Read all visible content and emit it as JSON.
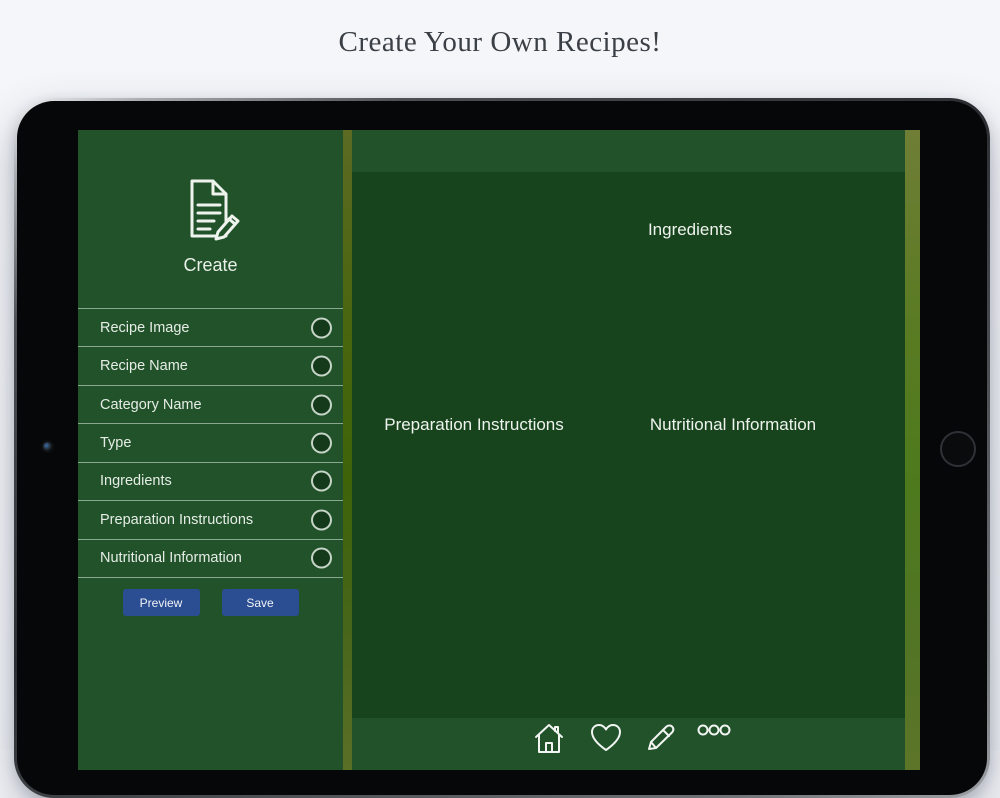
{
  "page": {
    "title": "Create Your Own Recipes!"
  },
  "sidebar": {
    "create_label": "Create",
    "items": [
      {
        "label": "Recipe Image"
      },
      {
        "label": "Recipe Name"
      },
      {
        "label": "Category Name"
      },
      {
        "label": "Type"
      },
      {
        "label": "Ingredients"
      },
      {
        "label": "Preparation Instructions"
      },
      {
        "label": "Nutritional Information"
      }
    ],
    "buttons": {
      "preview": "Preview",
      "save": "Save"
    }
  },
  "main": {
    "sections": {
      "ingredients": "Ingredients",
      "preparation": "Preparation Instructions",
      "nutrition": "Nutritional Information"
    }
  },
  "toolbar": {
    "icons": [
      "home-icon",
      "heart-icon",
      "pencil-icon",
      "more-icon"
    ]
  },
  "colors": {
    "sidebar_green": "#21522a",
    "panel_green": "#17441d",
    "divider_olive": "#4a660f",
    "button_blue": "#2b4d92",
    "title_text": "#3b4047",
    "page_background": "#f2f4f8"
  }
}
